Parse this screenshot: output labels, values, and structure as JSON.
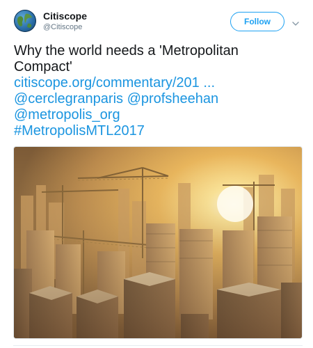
{
  "account": {
    "name": "Citiscope",
    "handle": "@Citiscope",
    "avatar_icon": "globe-icon"
  },
  "follow_button": {
    "label": "Follow"
  },
  "menu_icon": "chevron-down-icon",
  "tweet": {
    "text_line1": "Why the world needs a 'Metropolitan",
    "text_line2": "Compact'",
    "link": "citiscope.org/commentary/201 ...",
    "mentions": "@cerclegranparis @profsheehan",
    "mention2": "@metropolis_org",
    "hashtag": "#MetropolisMTL2017"
  },
  "media": {
    "image": "city-skyline-with-cranes-at-sunset-photo"
  },
  "colors": {
    "accent": "#1da1f2",
    "link": "#1b95e0",
    "text": "#14171a",
    "muted": "#657786"
  }
}
